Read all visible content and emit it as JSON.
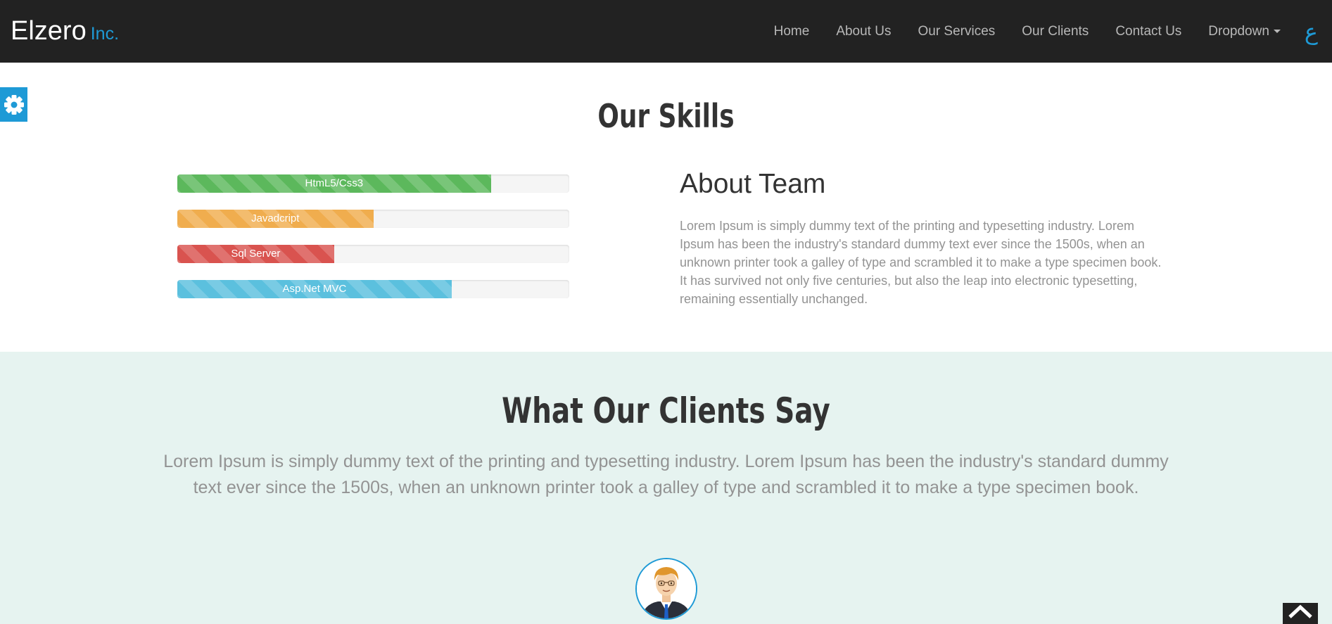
{
  "brand": {
    "name": "Elzero",
    "suffix": "Inc."
  },
  "nav": {
    "items": [
      "Home",
      "About Us",
      "Our Services",
      "Our Clients",
      "Contact Us"
    ],
    "dropdown_label": "Dropdown",
    "lang_label": "ع"
  },
  "settings": {
    "icon": "gear-icon"
  },
  "skills": {
    "title": "Our Skills",
    "bars": [
      {
        "label": "HtmL5/Css3",
        "percent": 80,
        "color": "#5cb85c"
      },
      {
        "label": "Javadcript",
        "percent": 50,
        "color": "#f0ad4e"
      },
      {
        "label": "Sql Server",
        "percent": 40,
        "color": "#d9534f"
      },
      {
        "label": "Asp.Net MVC",
        "percent": 70,
        "color": "#5bc0de"
      }
    ]
  },
  "about": {
    "title": "About Team",
    "text": "Lorem Ipsum is simply dummy text of the printing and typesetting industry. Lorem Ipsum has been the industry's standard dummy text ever since the 1500s, when an unknown printer took a galley of type and scrambled it to make a type specimen book. It has survived not only five centuries, but also the leap into electronic typesetting, remaining essentially unchanged."
  },
  "clients": {
    "title": "What Our Clients Say",
    "text": "Lorem Ipsum is simply dummy text of the printing and typesetting industry. Lorem Ipsum has been the industry's standard dummy text ever since the 1500s, when an unknown printer took a galley of type and scrambled it to make a type specimen book."
  },
  "colors": {
    "accent": "#1e9ad6",
    "navbar": "#222222",
    "clients_bg": "#e6f3f0"
  },
  "to_top": {
    "icon": "chevron-up-icon"
  }
}
